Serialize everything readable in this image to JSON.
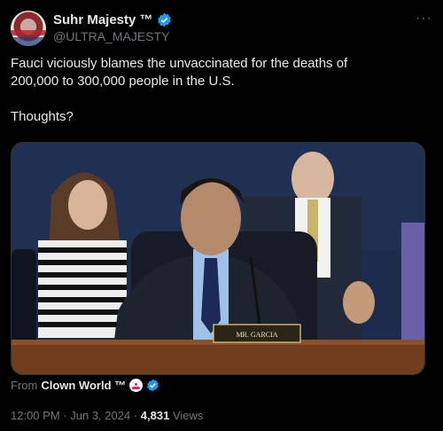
{
  "author": {
    "name": "Suhr Majesty ™",
    "handle": "@ULTRA_MAJESTY"
  },
  "tweet": {
    "text": "Fauci viciously blames the unvaccinated for the deaths of\n200,000 to 300,000 people in the U.S.\n\nThoughts?"
  },
  "media": {
    "nameplate": "MR. GARCIA"
  },
  "attribution": {
    "prefix": "From",
    "source_name": "Clown World ™"
  },
  "meta": {
    "time": "12:00 PM",
    "sep1": "·",
    "date": "Jun 3, 2024",
    "sep2": "·",
    "views_count": "4,831",
    "views_label": "Views"
  },
  "icons": {
    "verified": "verified-badge-icon",
    "more": "more-options-icon",
    "clown": "clown-emoji-icon"
  },
  "colors": {
    "background": "#000000",
    "text": "#e7e9ea",
    "secondary": "#71767b",
    "verified": "#1d9bf0"
  }
}
